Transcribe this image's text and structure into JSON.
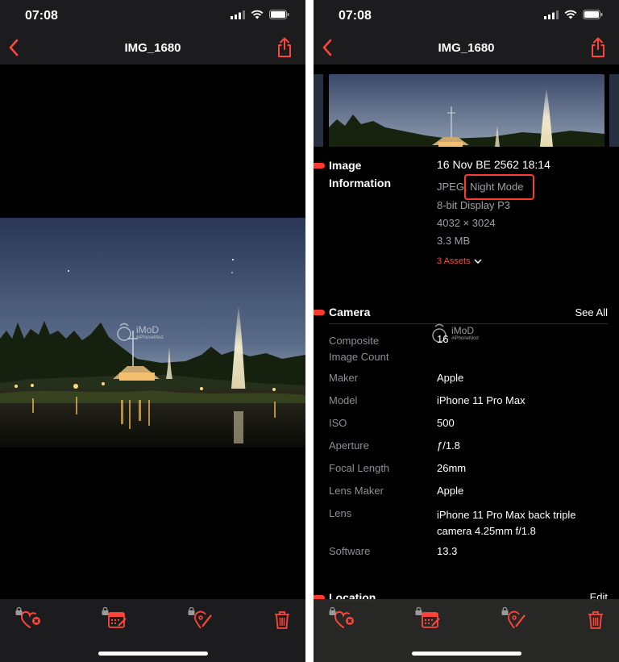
{
  "status": {
    "time": "07:08"
  },
  "nav": {
    "title": "IMG_1680"
  },
  "watermark": {
    "brand": "iMoD",
    "sub": "#iPhoneMod"
  },
  "info": {
    "section_title_line1": "Image",
    "section_title_line2": "Information",
    "date": "16 Nov BE 2562 18:14",
    "format_prefix": "JPEG,",
    "format_mode": "Night Mode",
    "color_profile": "8-bit Display P3",
    "dimensions": "4032 × 3024",
    "size": "3.3 MB",
    "assets": "3 Assets"
  },
  "camera": {
    "title": "Camera",
    "see_all": "See All",
    "rows": [
      {
        "label": "Composite Image Count",
        "label1": "Composite",
        "label2": "Image Count",
        "value": "16"
      },
      {
        "label": "Maker",
        "value": "Apple"
      },
      {
        "label": "Model",
        "value": "iPhone 11 Pro Max"
      },
      {
        "label": "ISO",
        "value": "500"
      },
      {
        "label": "Aperture",
        "value": "ƒ/1.8"
      },
      {
        "label": "Focal Length",
        "value": "26mm"
      },
      {
        "label": "Lens Maker",
        "value": "Apple"
      },
      {
        "label": "Lens",
        "value1": "iPhone 11 Pro Max back triple",
        "value2": "camera 4.25mm f/1.8"
      },
      {
        "label": "Software",
        "value": "13.3"
      }
    ]
  },
  "location": {
    "title": "Location",
    "edit": "Edit"
  },
  "colors": {
    "accent": "#ff453a",
    "bar": "#1c1c1e",
    "background": "#000000"
  },
  "icons": [
    "back-chevron-icon",
    "share-icon",
    "heart-remove-icon",
    "calendar-edit-icon",
    "location-edit-icon",
    "trash-icon",
    "lock-icon"
  ]
}
